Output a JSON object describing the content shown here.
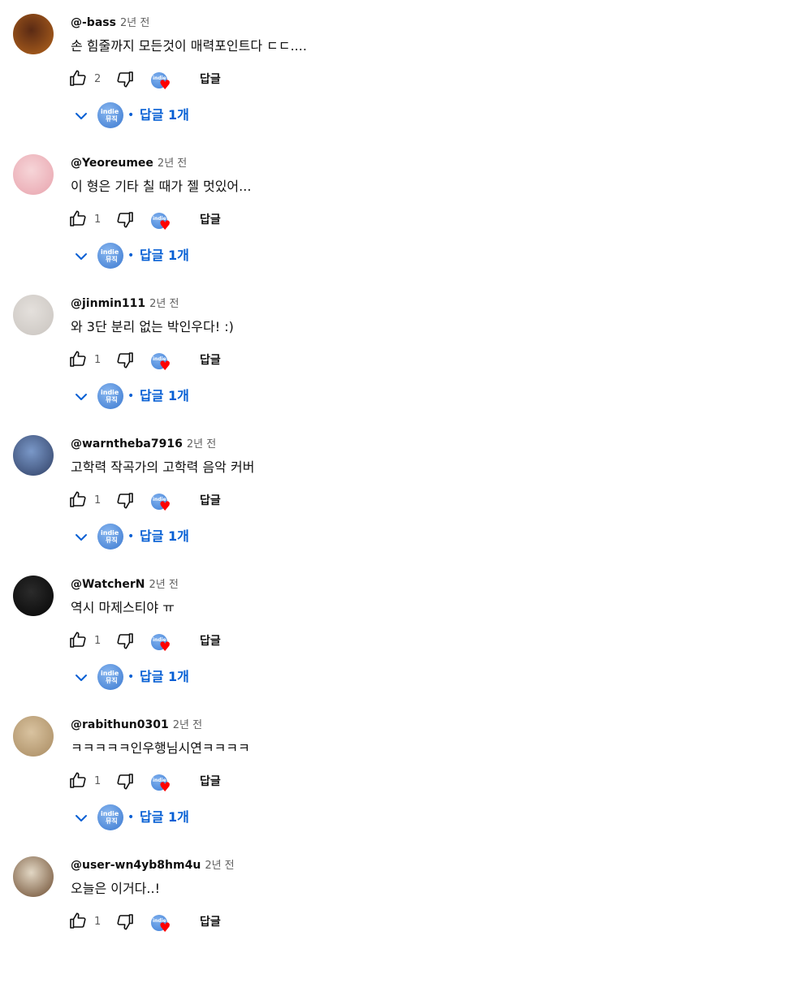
{
  "colors": {
    "link_blue": "#065fd4",
    "meta_gray": "#606060",
    "heart_red": "#ff0000"
  },
  "icons": {
    "like": "thumb-up-icon",
    "dislike": "thumb-down-icon",
    "creator_heart": "creator-heart-icon",
    "expand": "chevron-down-icon"
  },
  "comments": [
    {
      "author": "@-bass",
      "time": "2년 전",
      "text": "손 힘줄까지 모든것이 매력포인트다 ㄷㄷ....",
      "likes": "2",
      "reply_label": "답글",
      "replies_label": "답글 1개",
      "dot": "•",
      "avatar_colors": [
        "#5a2a14",
        "#b5651d"
      ]
    },
    {
      "author": "@Yeoreumee",
      "time": "2년 전",
      "text": "이 형은 기타 칠 때가 젤 멋있어...",
      "likes": "1",
      "reply_label": "답글",
      "replies_label": "답글 1개",
      "dot": "•",
      "avatar_colors": [
        "#f6d5d8",
        "#e8a3ad"
      ]
    },
    {
      "author": "@jinmin111",
      "time": "2년 전",
      "text": "와 3단 분리 없는 박인우다! :)",
      "likes": "1",
      "reply_label": "답글",
      "replies_label": "답글 1개",
      "dot": "•",
      "avatar_colors": [
        "#e4e0dc",
        "#c9c4bf"
      ]
    },
    {
      "author": "@warntheba7916",
      "time": "2년 전",
      "text": "고학력 작곡가의 고학력 음악 커버",
      "likes": "1",
      "reply_label": "답글",
      "replies_label": "답글 1개",
      "dot": "•",
      "avatar_colors": [
        "#7a98c8",
        "#2f3f64"
      ]
    },
    {
      "author": "@WatcherN",
      "time": "2년 전",
      "text": "역시 마제스티야 ㅠ",
      "likes": "1",
      "reply_label": "답글",
      "replies_label": "답글 1개",
      "dot": "•",
      "avatar_colors": [
        "#2b2b2b",
        "#050505"
      ]
    },
    {
      "author": "@rabithun0301",
      "time": "2년 전",
      "text": "ㅋㅋㅋㅋㅋ인우행님시연ㅋㅋㅋㅋ",
      "likes": "1",
      "reply_label": "답글",
      "replies_label": "답글 1개",
      "dot": "•",
      "avatar_colors": [
        "#d9c3a0",
        "#a88a60"
      ]
    },
    {
      "author": "@user-wn4yb8hm4u",
      "time": "2년 전",
      "text": "오늘은 이거다..!",
      "likes": "1",
      "reply_label": "답글",
      "dot": "•",
      "avatar_colors": [
        "#e2d7c4",
        "#6b4a2e"
      ]
    }
  ]
}
